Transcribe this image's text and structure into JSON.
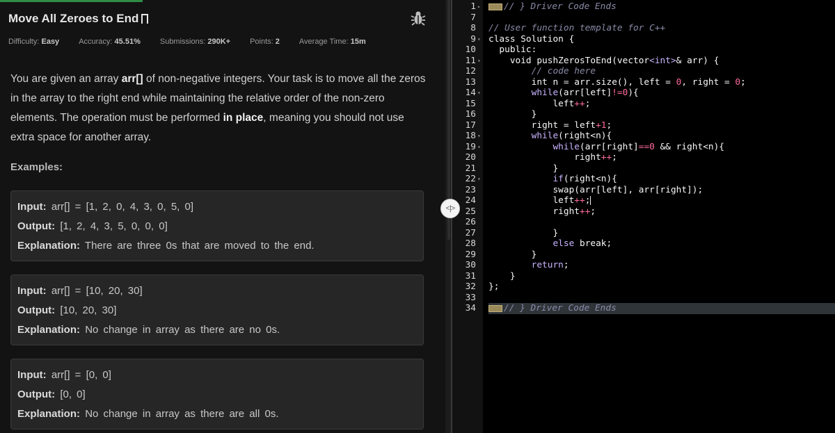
{
  "problem": {
    "title": "Move All Zeroes to End",
    "meta": {
      "difficulty_label": "Difficulty:",
      "difficulty": "Easy",
      "accuracy_label": "Accuracy:",
      "accuracy": "45.51%",
      "submissions_label": "Submissions:",
      "submissions": "290K+",
      "points_label": "Points:",
      "points": "2",
      "time_label": "Average Time:",
      "time": "15m"
    },
    "description": {
      "p1": "You are given an array ",
      "b1": "arr[]",
      "p2": " of non-negative integers. Your task is to move all the zeros in the array to the right end while maintaining the relative order of the non-zero elements. The operation must be performed ",
      "b2": "in place",
      "p3": ", meaning you should not use extra space for another array."
    },
    "examples_heading": "Examples:",
    "examples": [
      {
        "input_label": "Input:",
        "input": "arr[] = [1, 2, 0, 4, 3, 0, 5, 0]",
        "output_label": "Output:",
        "output": "[1, 2, 4, 3, 5, 0, 0, 0]",
        "explanation_label": "Explanation:",
        "explanation": "There are three 0s that are moved to the end."
      },
      {
        "input_label": "Input:",
        "input": "arr[] = [10, 20, 30]",
        "output_label": "Output:",
        "output": "[10, 20, 30]",
        "explanation_label": "Explanation:",
        "explanation": "No change in array as there are no 0s."
      },
      {
        "input_label": "Input:",
        "input": "arr[] = [0, 0]",
        "output_label": "Output:",
        "output": "[0, 0]",
        "explanation_label": "Explanation:",
        "explanation": "No change in array as there are all 0s."
      }
    ]
  },
  "splitter": {
    "icon": "<|>"
  },
  "editor": {
    "lines": [
      {
        "n": "1",
        "fold": "▸",
        "html": "<span class='foldw'></span><span class='cm'>// } Driver Code Ends</span>"
      },
      {
        "n": "7",
        "fold": "",
        "html": ""
      },
      {
        "n": "8",
        "fold": "",
        "html": "<span class='cm'>// User function template for C++</span>"
      },
      {
        "n": "9",
        "fold": "▾",
        "html": "class Solution {"
      },
      {
        "n": "10",
        "fold": "",
        "html": "  public:"
      },
      {
        "n": "11",
        "fold": "▾",
        "html": "    void pushZerosToEnd(vector<span class='kw'>&lt;int&gt;</span>&amp; arr) {"
      },
      {
        "n": "12",
        "fold": "",
        "html": "        <span class='cm'>// code here</span>"
      },
      {
        "n": "13",
        "fold": "",
        "html": "        int n = arr.size(), left = <span class='nm'>0</span>, right = <span class='nm'>0</span>;"
      },
      {
        "n": "14",
        "fold": "▾",
        "html": "        <span class='kw'>while</span>(arr[left]<span class='nm'>!=0</span>){"
      },
      {
        "n": "15",
        "fold": "",
        "html": "            left<span class='nm'>++</span>;"
      },
      {
        "n": "16",
        "fold": "",
        "html": "        }"
      },
      {
        "n": "17",
        "fold": "",
        "html": "        right = left<span class='nm'>+1</span>;"
      },
      {
        "n": "18",
        "fold": "▾",
        "html": "        <span class='kw'>while</span>(right&lt;n){"
      },
      {
        "n": "19",
        "fold": "▾",
        "html": "            <span class='kw'>while</span>(arr[right]<span class='nm'>==0</span> &amp;&amp; right&lt;n){"
      },
      {
        "n": "20",
        "fold": "",
        "html": "                right<span class='nm'>++</span>;"
      },
      {
        "n": "21",
        "fold": "",
        "html": "            }"
      },
      {
        "n": "22",
        "fold": "▾",
        "html": "            <span class='kw'>if</span>(right&lt;n){"
      },
      {
        "n": "23",
        "fold": "",
        "html": "            swap(arr[left], arr[right]);"
      },
      {
        "n": "24",
        "fold": "",
        "html": "            left<span class='nm'>++</span>;<span class='cursor'></span>"
      },
      {
        "n": "25",
        "fold": "",
        "html": "            right<span class='nm'>++</span>;"
      },
      {
        "n": "26",
        "fold": "",
        "html": ""
      },
      {
        "n": "27",
        "fold": "",
        "html": "            }"
      },
      {
        "n": "28",
        "fold": "",
        "html": "            <span class='kw'>else</span> break;"
      },
      {
        "n": "29",
        "fold": "",
        "html": "        }"
      },
      {
        "n": "30",
        "fold": "",
        "html": "        <span class='kw'>return</span>;"
      },
      {
        "n": "31",
        "fold": "",
        "html": "    }"
      },
      {
        "n": "32",
        "fold": "",
        "html": "};"
      },
      {
        "n": "33",
        "fold": "",
        "html": ""
      },
      {
        "n": "34",
        "fold": "",
        "html": "<span class='foldw'></span><span class='cm'>// } Driver Code Ends</span>"
      }
    ]
  }
}
